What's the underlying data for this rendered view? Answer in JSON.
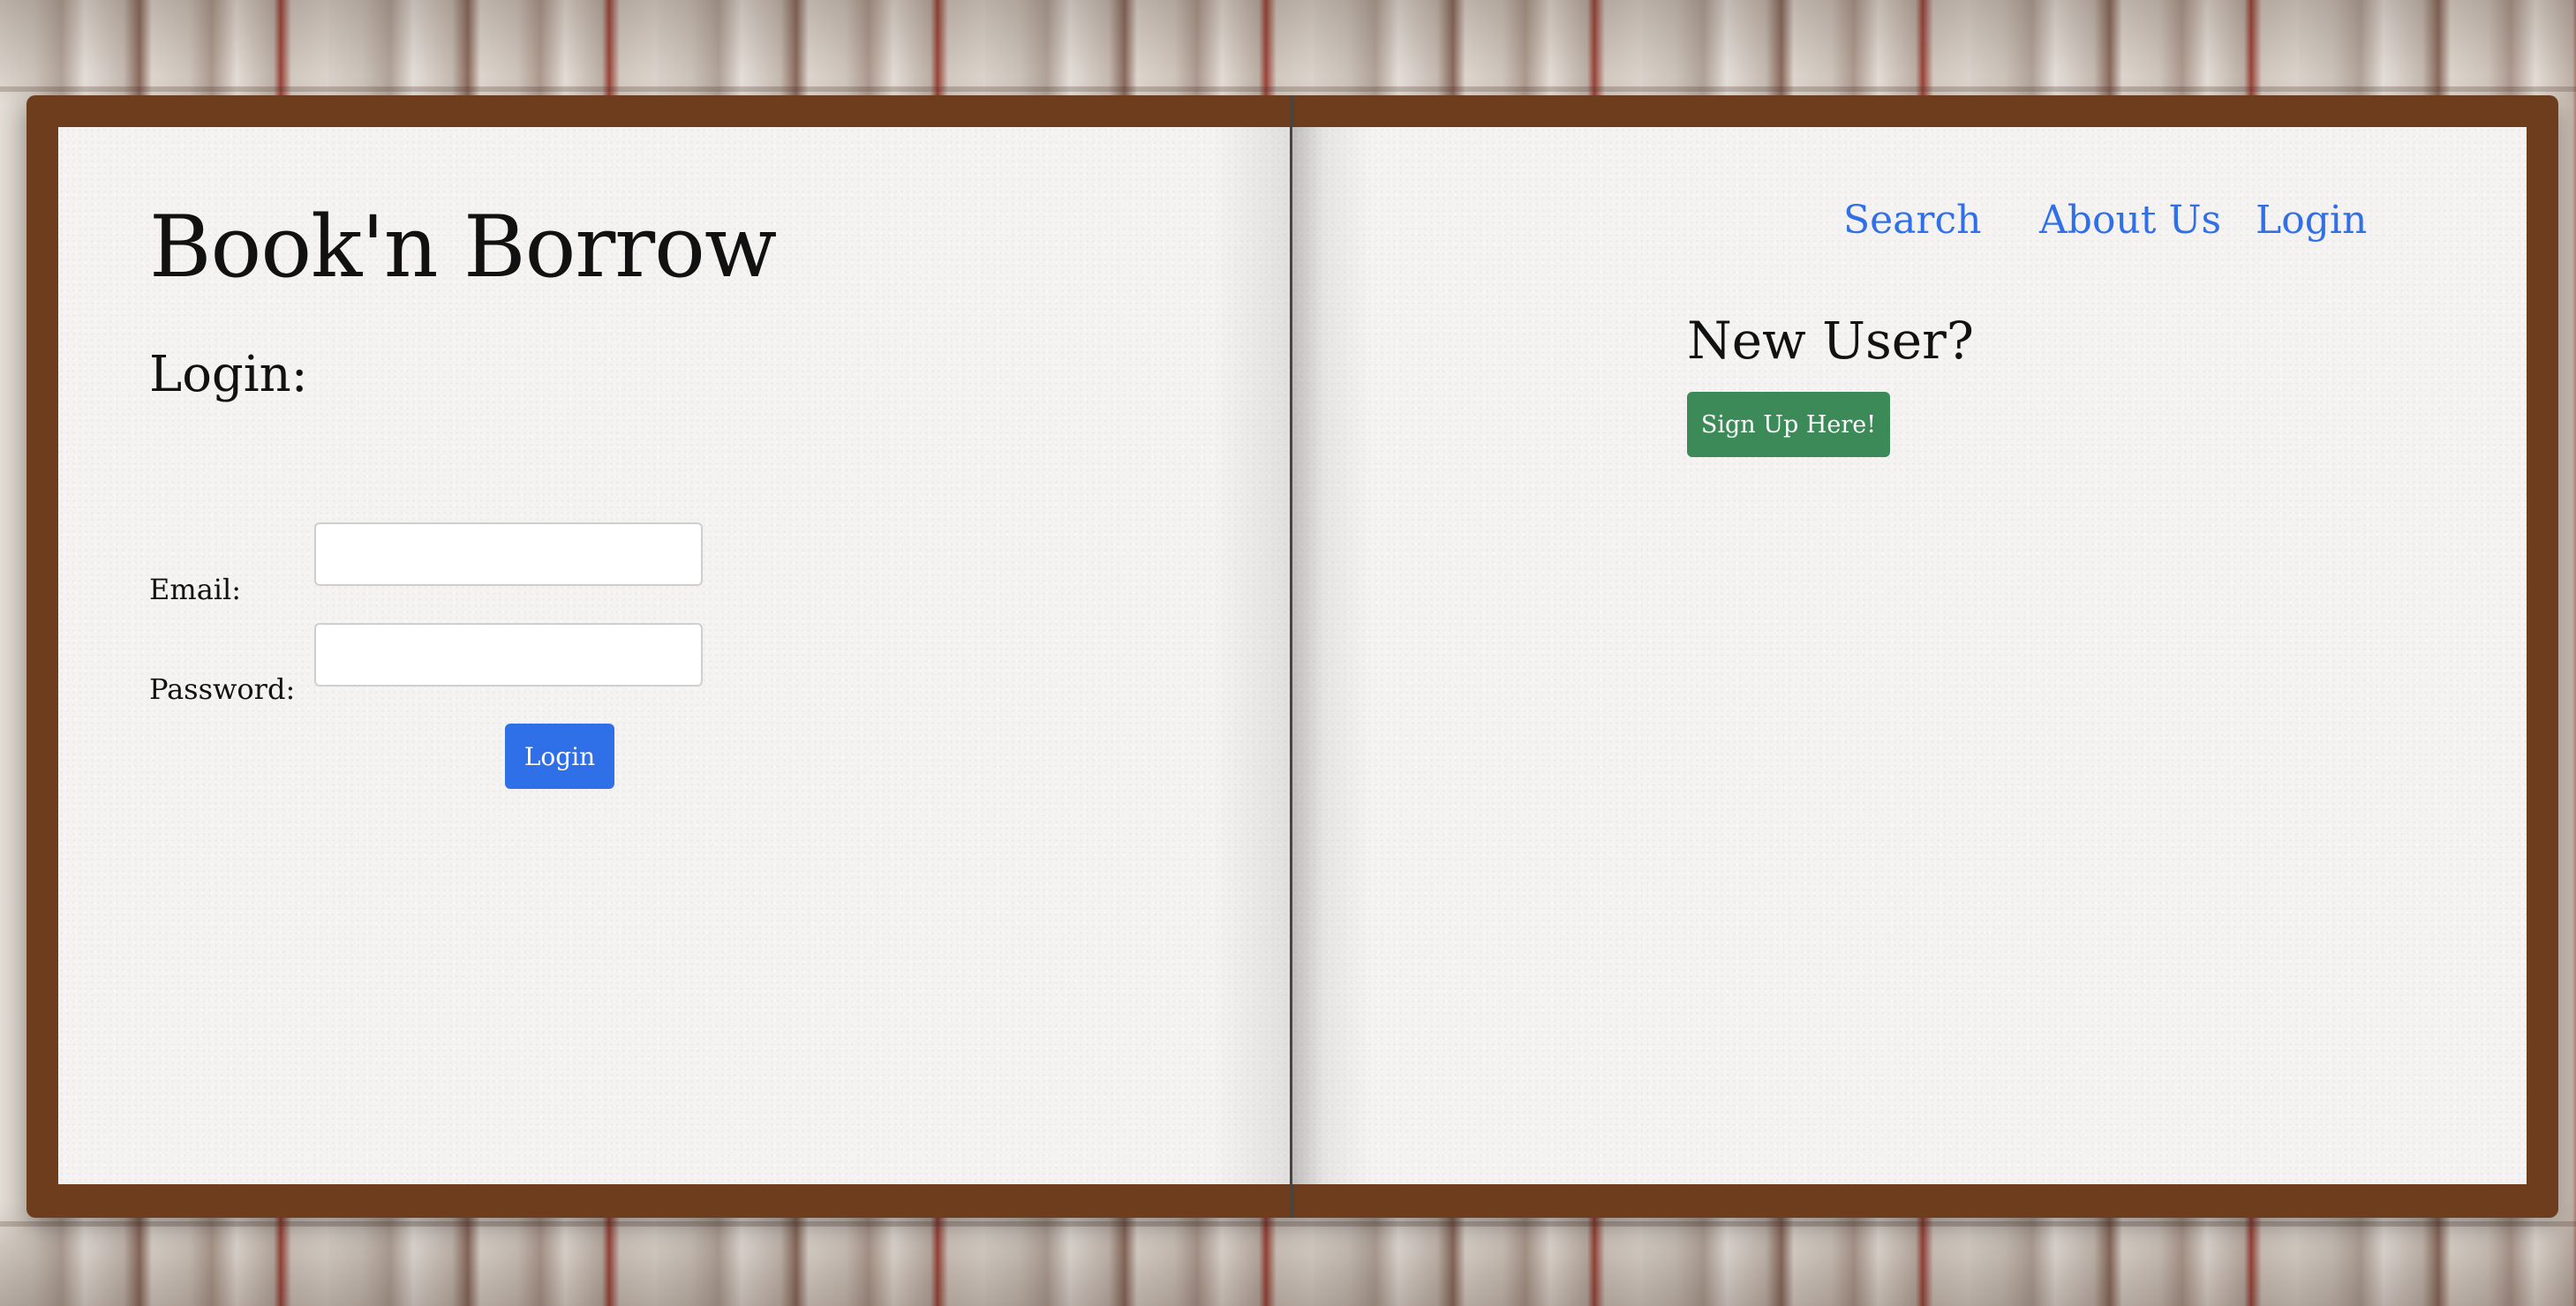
{
  "site": {
    "title": "Book'n Borrow"
  },
  "nav": {
    "items": [
      {
        "label": "Search"
      },
      {
        "label": "About Us"
      },
      {
        "label": "Login"
      }
    ]
  },
  "login_form": {
    "heading": "Login:",
    "email_label": "Email:",
    "email_value": "",
    "password_label": "Password:",
    "password_value": "",
    "submit_label": "Login"
  },
  "signup": {
    "heading": "New User?",
    "button_label": "Sign Up Here!"
  },
  "colors": {
    "link": "#2f6fe8",
    "primary_button": "#2f6fe8",
    "success_button": "#3c8a57",
    "book_cover": "#6e3d1e",
    "page": "#f5f3f1"
  }
}
